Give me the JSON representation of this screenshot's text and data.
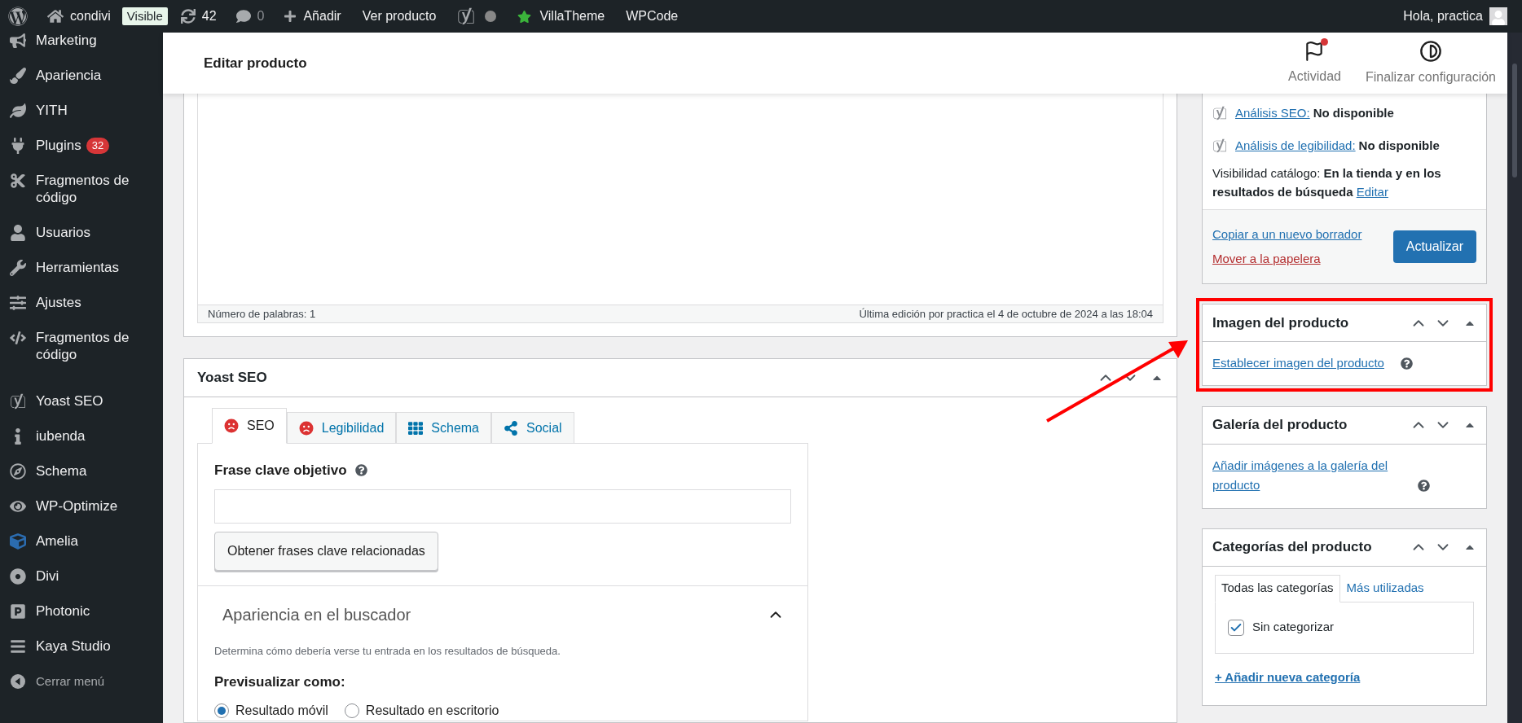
{
  "admin_bar": {
    "items": [
      {
        "kind": "logo"
      },
      {
        "kind": "site",
        "label": "condivi"
      },
      {
        "kind": "badge",
        "label": "Visible"
      },
      {
        "kind": "updates",
        "label": "42"
      },
      {
        "kind": "comments",
        "label": "0"
      },
      {
        "kind": "new",
        "label": "Añadir"
      },
      {
        "kind": "link",
        "label": "Ver producto"
      },
      {
        "kind": "yoast"
      },
      {
        "kind": "star",
        "label": "VillaTheme"
      },
      {
        "kind": "link",
        "label": "WPCode"
      }
    ],
    "greeting": "Hola, practica"
  },
  "sidebar": {
    "items": [
      {
        "kind": "menu",
        "label": "Marketing"
      },
      {
        "kind": "menu",
        "label": "Apariencia"
      },
      {
        "kind": "menu",
        "label": "YITH"
      },
      {
        "kind": "menu",
        "label": "Plugins",
        "badge": "32"
      },
      {
        "kind": "menu",
        "label": "Fragmentos de código"
      },
      {
        "kind": "menu",
        "label": "Usuarios"
      },
      {
        "kind": "menu",
        "label": "Herramientas"
      },
      {
        "kind": "menu",
        "label": "Ajustes"
      },
      {
        "kind": "menu",
        "label": "Fragmentos de código"
      },
      {
        "kind": "menu",
        "label": "Yoast SEO"
      },
      {
        "kind": "menu",
        "label": "iubenda"
      },
      {
        "kind": "menu",
        "label": "Schema"
      },
      {
        "kind": "menu",
        "label": "WP-Optimize"
      },
      {
        "kind": "menu",
        "label": "Amelia"
      },
      {
        "kind": "menu",
        "label": "Divi"
      },
      {
        "kind": "menu",
        "label": "Photonic"
      },
      {
        "kind": "menu",
        "label": "Kaya Studio"
      },
      {
        "kind": "collapse",
        "label": "Cerrar menú"
      }
    ]
  },
  "header": {
    "title": "Editar producto",
    "actions": [
      {
        "kind": "activity",
        "label": "Actividad",
        "notification": true
      },
      {
        "kind": "setup",
        "label": "Finalizar configuración"
      }
    ]
  },
  "editor": {
    "word_count": "Número de palabras: 1",
    "last_edit": "Última edición por practica el 4 de octubre de 2024 a las 18:04"
  },
  "yoast": {
    "title": "Yoast SEO",
    "tabs": [
      {
        "label": "SEO",
        "kind": "score",
        "selected": true
      },
      {
        "label": "Legibilidad",
        "kind": "score",
        "selected": false
      },
      {
        "label": "Schema",
        "kind": "grid",
        "selected": false
      },
      {
        "label": "Social",
        "kind": "share",
        "selected": false
      }
    ],
    "focus_keyphrase": {
      "label": "Frase clave objetivo"
    },
    "related_button": "Obtener frases clave relacionadas",
    "search_appearance": {
      "title": "Apariencia en el buscador",
      "expanded": true,
      "description": "Determina cómo debería verse tu entrada en los resultados de búsqueda.",
      "preview_label": "Previsualizar como:",
      "options": [
        {
          "label": "Resultado móvil",
          "selected": true
        },
        {
          "label": "Resultado en escritorio",
          "selected": false
        }
      ]
    }
  },
  "publish": {
    "analyses": [
      {
        "link": "Análisis SEO:",
        "value": "No disponible"
      },
      {
        "link": "Análisis de legibilidad:",
        "value": "No disponible"
      }
    ],
    "visibility": {
      "label": "Visibilidad catálogo:",
      "value": "En la tienda y en los resultados de búsqueda",
      "link": "Editar"
    },
    "copy_link": "Copiar a un nuevo borrador",
    "trash_link": "Mover a la papelera",
    "update_button": "Actualizar"
  },
  "product_image": {
    "title": "Imagen del producto",
    "link": "Establecer imagen del producto",
    "highlighted": true
  },
  "gallery": {
    "title": "Galería del producto",
    "link": "Añadir imágenes a la galería del producto"
  },
  "categories": {
    "title": "Categorías del producto",
    "tabs": [
      {
        "label": "Todas las categorías",
        "selected": true
      },
      {
        "label": "Más utilizadas",
        "selected": false
      }
    ],
    "items": [
      {
        "label": "Sin categorizar",
        "checked": true
      }
    ],
    "add_link": "+ Añadir nueva categoría"
  }
}
